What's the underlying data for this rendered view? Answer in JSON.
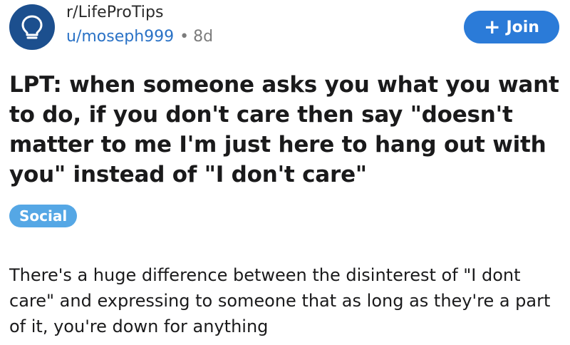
{
  "header": {
    "subreddit": "r/LifeProTips",
    "username": "u/moseph999",
    "separator": "•",
    "age": "8d",
    "avatar_icon": "lightbulb-icon",
    "join_icon": "plus-icon",
    "join_label": "Join"
  },
  "post": {
    "title": "LPT: when someone asks you what you want to do, if you don't care then say \"doesn't matter to me I'm just here to hang out with you\" instead of \"I don't care\"",
    "flair": "Social",
    "body": "There's a huge difference between the disinterest of \"I dont care\" and expressing to someone that as long as they're a part of it, you're down for anything"
  },
  "colors": {
    "avatar_bg": "#1c4f8e",
    "username": "#2a72c6",
    "join_button": "#2b7bd8",
    "flair_bg": "#55a7e5",
    "text": "#1a1a1b"
  }
}
